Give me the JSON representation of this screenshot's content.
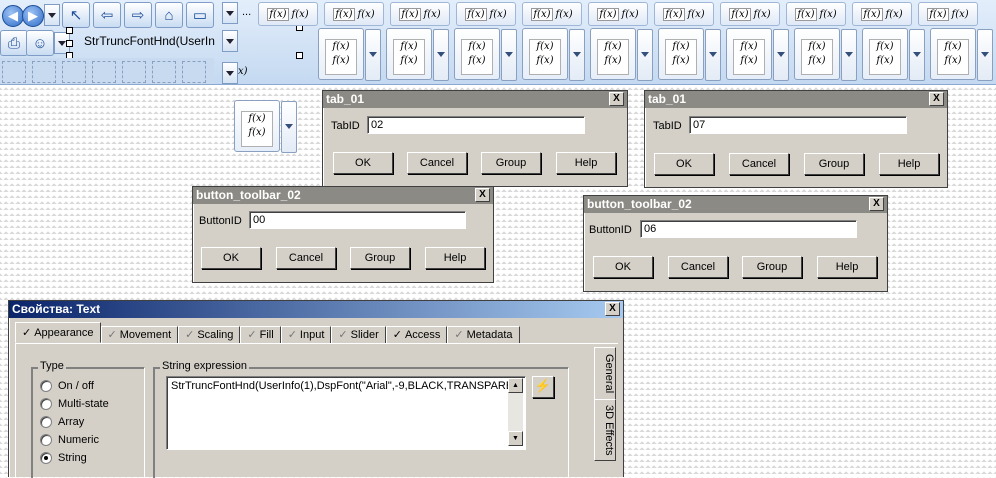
{
  "toolbar": {
    "ellipsis": "...",
    "combo_text": "StrTruncFontHnd(UserIn",
    "fx_top": "f(x)",
    "fx_bottom": "f(x)",
    "fx_fragment": "x)",
    "tab_cell_count": 11,
    "button_cell_count": 10
  },
  "dialogs": {
    "tab1": {
      "title": "tab_01",
      "field_label": "TabID",
      "value": "02"
    },
    "tab2": {
      "title": "tab_01",
      "field_label": "TabID",
      "value": "07"
    },
    "btn1": {
      "title": "button_toolbar_02",
      "field_label": "ButtonID",
      "value": "00"
    },
    "btn2": {
      "title": "button_toolbar_02",
      "field_label": "ButtonID",
      "value": "06"
    },
    "buttons": {
      "ok": "OK",
      "cancel": "Cancel",
      "group": "Group",
      "help": "Help"
    },
    "close": "X"
  },
  "properties": {
    "title": "Свойства: Text",
    "tabs": [
      {
        "label": "Appearance",
        "checked": true
      },
      {
        "label": "Movement",
        "checked": false
      },
      {
        "label": "Scaling",
        "checked": false
      },
      {
        "label": "Fill",
        "checked": false
      },
      {
        "label": "Input",
        "checked": false
      },
      {
        "label": "Slider",
        "checked": false
      },
      {
        "label": "Access",
        "checked": true
      },
      {
        "label": "Metadata",
        "checked": false
      }
    ],
    "type_group_label": "Type",
    "type_options": [
      "On / off",
      "Multi-state",
      "Array",
      "Numeric",
      "String"
    ],
    "type_selected": "String",
    "string_expr_label": "String expression",
    "string_expr_value": "StrTruncFontHnd(UserInfo(1),DspFont(\"Arial\",-9,BLACK,TRANSPAREI",
    "side_tabs": [
      "General",
      "3D Effects"
    ]
  }
}
